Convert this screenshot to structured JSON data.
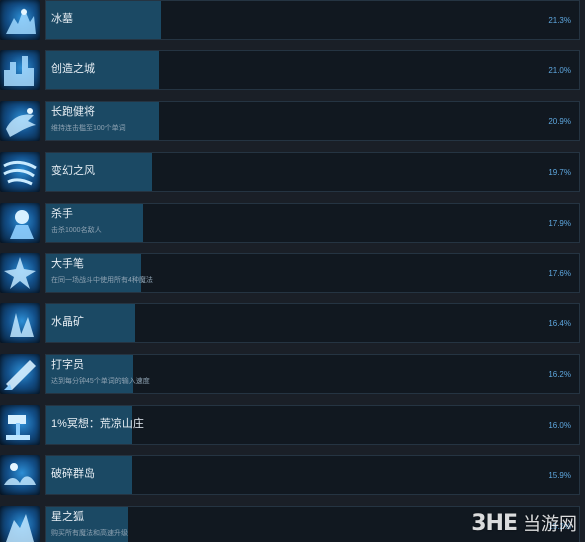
{
  "achievements": [
    {
      "name": "冰墓",
      "desc": "",
      "percent": "21.3%",
      "fill": 0.213,
      "icon": "ice-tomb-icon"
    },
    {
      "name": "创造之城",
      "desc": "",
      "percent": "21.0%",
      "fill": 0.21,
      "icon": "city-icon"
    },
    {
      "name": "长跑健将",
      "desc": "维持连击槛至100个单词",
      "percent": "20.9%",
      "fill": 0.209,
      "icon": "runner-icon"
    },
    {
      "name": "变幻之风",
      "desc": "",
      "percent": "19.7%",
      "fill": 0.197,
      "icon": "wind-icon"
    },
    {
      "name": "杀手",
      "desc": "击杀1000名敌人",
      "percent": "17.9%",
      "fill": 0.179,
      "icon": "killer-icon"
    },
    {
      "name": "大手笔",
      "desc": "在同一场战斗中使用所有4种魔法",
      "percent": "17.6%",
      "fill": 0.176,
      "icon": "magic-icon"
    },
    {
      "name": "水晶矿",
      "desc": "",
      "percent": "16.4%",
      "fill": 0.164,
      "icon": "crystal-mine-icon"
    },
    {
      "name": "打字员",
      "desc": "达到每分钟45个单词的输入速度",
      "percent": "16.2%",
      "fill": 0.162,
      "icon": "typist-icon"
    },
    {
      "name": "1%冥想：荒凉山庄",
      "desc": "",
      "percent": "16.0%",
      "fill": 0.16,
      "icon": "hammer-icon"
    },
    {
      "name": "破碎群岛",
      "desc": "",
      "percent": "15.9%",
      "fill": 0.159,
      "icon": "islands-icon"
    },
    {
      "name": "星之狐",
      "desc": "购买所有魔法和高速升级",
      "percent": "15.2%",
      "fill": 0.152,
      "icon": "star-fox-icon"
    }
  ],
  "watermark": {
    "brand": "3HE",
    "site": "当游网"
  }
}
